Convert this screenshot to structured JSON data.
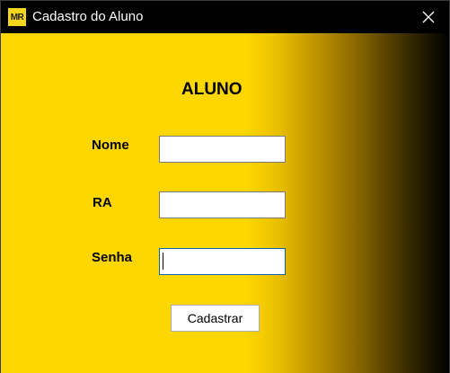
{
  "window": {
    "title": "Cadastro do Aluno",
    "icon_text": "MR",
    "close_glyph": "✕"
  },
  "form": {
    "heading": "ALUNO",
    "nome_label": "Nome",
    "nome_value": "",
    "ra_label": "RA",
    "ra_value": "",
    "senha_label": "Senha",
    "senha_value": "",
    "submit_label": "Cadastrar"
  },
  "colors": {
    "background_start": "#fed600",
    "background_end": "#000000",
    "focus_border": "#0a66a8",
    "titlebar": "#000000"
  },
  "icons": {
    "app": "mr-logo-icon",
    "close": "close-icon"
  }
}
